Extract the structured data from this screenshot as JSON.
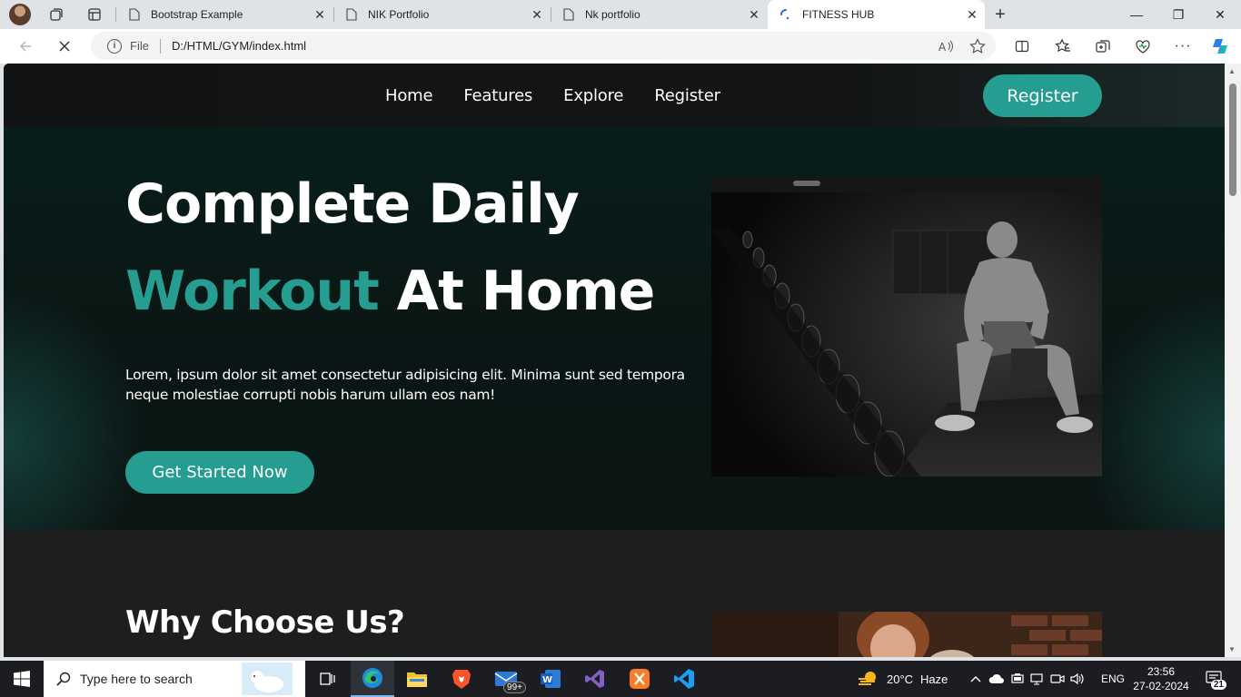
{
  "browser": {
    "tabs": [
      {
        "title": "Bootstrap Example",
        "close": "✕"
      },
      {
        "title": "NIK Portfolio",
        "close": "✕"
      },
      {
        "title": "Nk portfolio",
        "close": "✕"
      },
      {
        "title": "FITNESS HUB",
        "close": "✕",
        "active": true
      }
    ],
    "new_tab": "+",
    "window_controls": {
      "minimize": "—",
      "restore": "❐",
      "close": "✕"
    },
    "address": {
      "protocol_label": "File",
      "url": "D:/HTML/GYM/index.html"
    }
  },
  "site": {
    "nav": {
      "links": [
        "Home",
        "Features",
        "Explore",
        "Register"
      ],
      "register_button": "Register"
    },
    "hero": {
      "line1": "Complete Daily",
      "line2_accent": "Workout",
      "line2_rest": " At Home",
      "description": "Lorem, ipsum dolor sit amet consectetur adipisicing elit. Minima sunt sed tempora neque molestiae corrupti nobis harum ullam eos nam!",
      "cta": "Get Started Now"
    },
    "section2": {
      "title": "Why Choose Us?"
    },
    "colors": {
      "accent": "#259d90",
      "nav_bg": "#131516",
      "hero_bg": "#0a1715",
      "section_bg": "#1e1e1f"
    }
  },
  "taskbar": {
    "search_placeholder": "Type here to search",
    "mail_badge": "99+",
    "weather": {
      "temp": "20°C",
      "condition": "Haze"
    },
    "language": "ENG",
    "time": "23:56",
    "date": "27-02-2024",
    "notifications": "21"
  }
}
